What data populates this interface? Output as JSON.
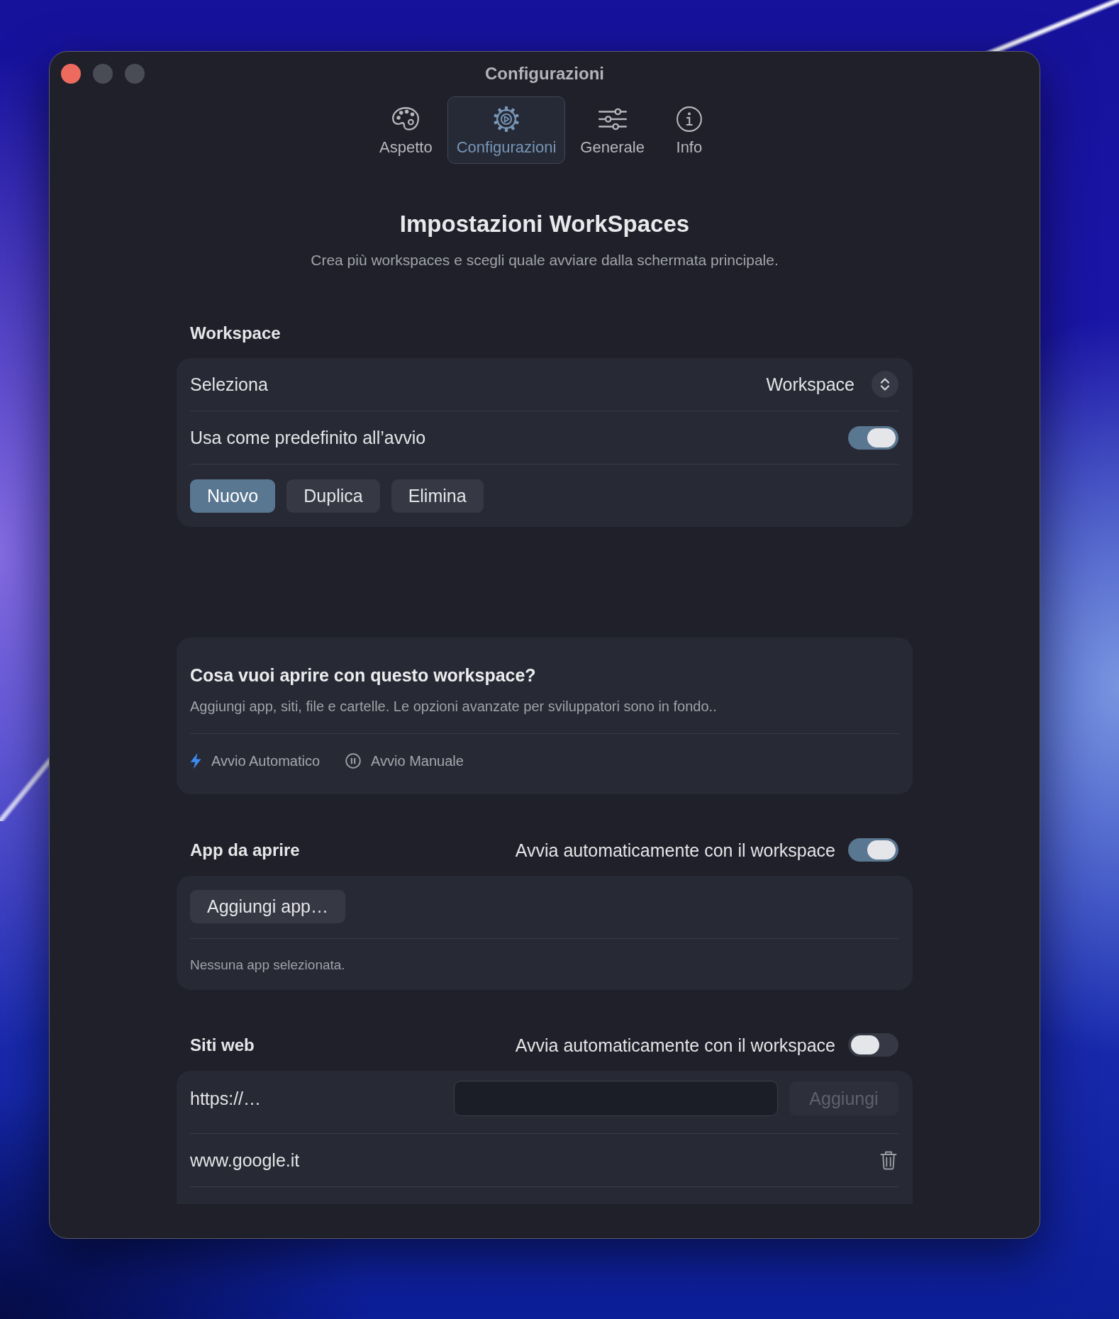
{
  "window": {
    "title": "Configurazioni",
    "controls": [
      {
        "kind": "close",
        "disabled": false
      },
      {
        "kind": "minimize",
        "disabled": true
      },
      {
        "kind": "zoom",
        "disabled": true
      }
    ]
  },
  "tabs": [
    {
      "label": "Aspetto",
      "selected": false
    },
    {
      "label": "Configurazioni",
      "selected": true
    },
    {
      "label": "Generale",
      "selected": false
    },
    {
      "label": "Info",
      "selected": false
    }
  ],
  "header": {
    "title": "Impostazioni WorkSpaces",
    "subtitle": "Crea più workspaces e scegli quale avviare dalla schermata principale."
  },
  "workspace": {
    "section_label": "Workspace",
    "select_label": "Seleziona",
    "select_value": "Workspace",
    "default_label": "Usa come predefinito all’avvio",
    "default_on": true,
    "buttons": [
      {
        "label": "Nuovo",
        "prominent": true
      },
      {
        "label": "Duplica",
        "prominent": false
      },
      {
        "label": "Elimina",
        "prominent": false
      }
    ]
  },
  "intro": {
    "title": "Cosa vuoi aprire con questo workspace?",
    "description": "Aggiungi app, siti, file e cartelle. Le opzioni avanzate per sviluppatori sono in fondo..",
    "legend": [
      {
        "kind": "automatic",
        "label": "Avvio Automatico"
      },
      {
        "kind": "manual",
        "label": "Avvio Manuale"
      }
    ]
  },
  "apps": {
    "section_label": "App da aprire",
    "autostart_label": "Avvia automaticamente con il workspace",
    "autostart_on": true,
    "add_button": "Aggiungi app…",
    "empty_text": "Nessuna app selezionata."
  },
  "websites": {
    "section_label": "Siti web",
    "autostart_label": "Avvia automaticamente con il workspace",
    "autostart_on": false,
    "url_label": "https://…",
    "add_button": {
      "label": "Aggiungi",
      "disabled": true
    },
    "sites": [
      {
        "url": "www.google.it"
      }
    ]
  }
}
